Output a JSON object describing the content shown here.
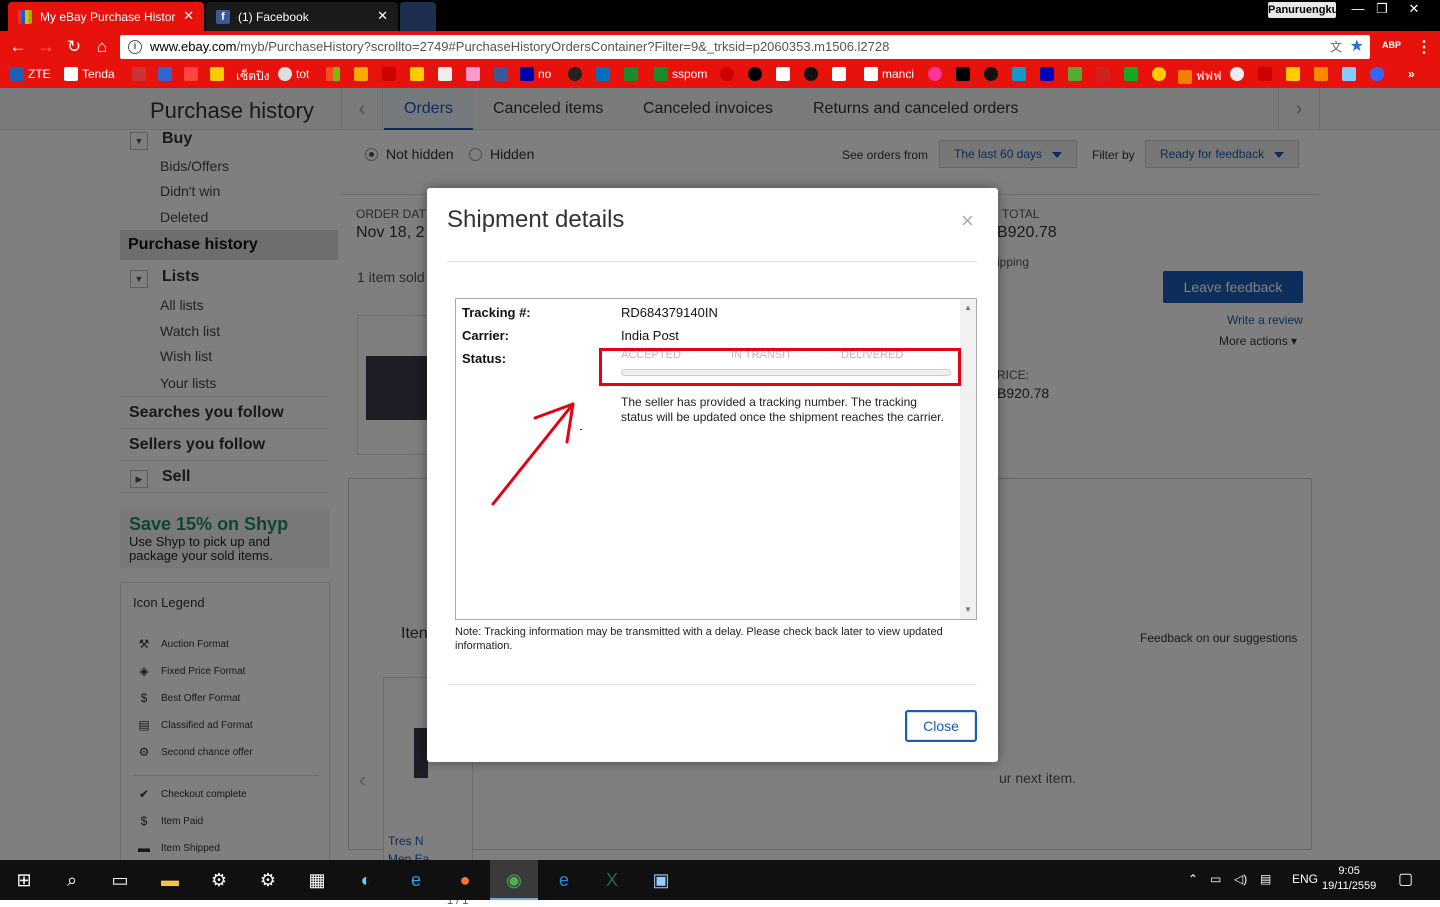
{
  "browser": {
    "tabs": [
      {
        "title": "My eBay Purchase Histor",
        "active": true
      },
      {
        "title": "(1) Facebook",
        "active": false
      }
    ],
    "profile": "Panuruengkunk",
    "url_host": "www.ebay.com",
    "url_path": "/myb/PurchaseHistory?scrollto=2749#PurchaseHistoryOrdersContainer?Filter=9&_trksid=p2060353.m1506.l2728",
    "abp_label": "ABP",
    "bookmarks": [
      "ZTE",
      "Tenda",
      "เซ็ตปิง",
      "tot",
      "no",
      "sspom",
      "manci",
      "ฟฟฟ"
    ]
  },
  "page": {
    "title": "Purchase history",
    "tabs": [
      "Orders",
      "Canceled items",
      "Canceled invoices",
      "Returns and canceled orders"
    ],
    "active_tab": "Orders",
    "sidebar": {
      "buy": "Buy",
      "buy_items": [
        "Bids/Offers",
        "Didn't win",
        "Deleted"
      ],
      "active": "Purchase history",
      "lists": "Lists",
      "list_items": [
        "All lists",
        "Watch list",
        "Wish list",
        "Your lists"
      ],
      "searches": "Searches you follow",
      "sellers": "Sellers you follow",
      "sell": "Sell",
      "promo_title": "Save 15% on Shyp",
      "promo_text": "Use Shyp to pick up and package your sold items.",
      "legend_title": "Icon Legend",
      "legend_items": [
        "Auction Format",
        "Fixed Price Format",
        "Best Offer Format",
        "Classified ad Format",
        "Second chance offer",
        "Checkout complete",
        "Item Paid",
        "Item Shipped"
      ]
    },
    "filters": {
      "not_hidden": "Not hidden",
      "hidden": "Hidden",
      "see_orders_label": "See orders from",
      "period": "The last 60 days",
      "filter_by_label": "Filter by",
      "filter_value": "Ready for feedback"
    },
    "order": {
      "date_label": "ORDER DAT",
      "date": "Nov 18, 2",
      "items_sold": "1 item sold",
      "total_label": "TOTAL",
      "total": "B920.78",
      "shipping": "ipping",
      "price_label": "RICE:",
      "price": "B920.78",
      "leave_feedback": "Leave feedback",
      "write_review": "Write a review",
      "more_actions": "More actions"
    },
    "suggestions": {
      "heading": "Iten",
      "feedback": "Feedback on our suggestions",
      "next_item": "ur next item.",
      "item_title_1": "Tres N",
      "item_title_2": "Men Ea",
      "pager": "1 / 1"
    }
  },
  "modal": {
    "title": "Shipment details",
    "tracking_label": "Tracking #:",
    "tracking": "RD684379140IN",
    "carrier_label": "Carrier:",
    "carrier": "India Post",
    "status_label": "Status:",
    "steps": [
      "ACCEPTED",
      "IN TRANSIT",
      "DELIVERED"
    ],
    "progress": 0,
    "message": "The seller has provided a tracking number. The tracking status will be updated once the shipment reaches the carrier.",
    "note": "Note: Tracking information may be transmitted with a delay. Please check back later to view updated information.",
    "close": "Close",
    "highlight_color": "#e60012"
  },
  "taskbar": {
    "lang": "ENG",
    "time": "9:05",
    "date": "19/11/2559"
  }
}
